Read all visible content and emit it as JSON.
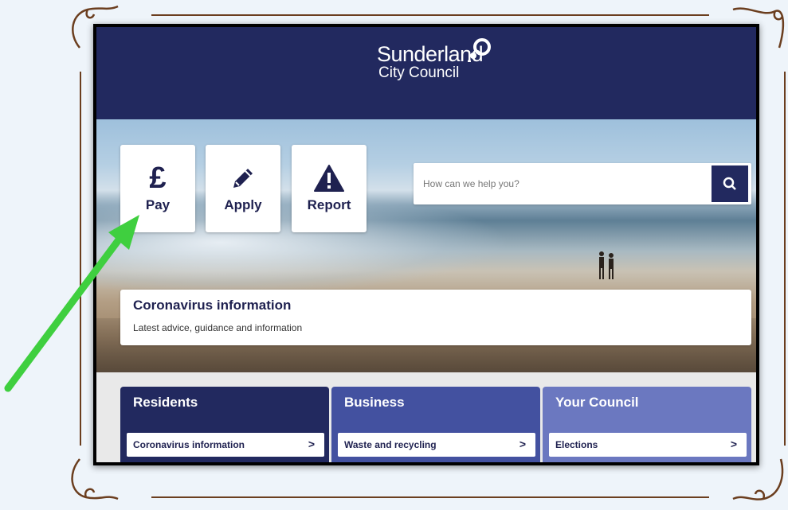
{
  "colors": {
    "header_navy": "#22295f",
    "tab_residents": "#22295f",
    "tab_business": "#4351a0",
    "tab_council": "#6b78c0",
    "arrow_green": "#3fcf3f",
    "frame_brown": "#6b3e1f"
  },
  "header": {
    "logo_line1": "Sunderland",
    "logo_line2": "City Council"
  },
  "quick_actions": [
    {
      "label": "Pay",
      "icon": "pound-icon"
    },
    {
      "label": "Apply",
      "icon": "pencil-icon"
    },
    {
      "label": "Report",
      "icon": "warning-icon"
    }
  ],
  "search": {
    "placeholder": "How can we help you?",
    "icon": "search-icon"
  },
  "covid": {
    "title": "Coronavirus information",
    "subtitle": "Latest advice, guidance and information"
  },
  "tabs": [
    {
      "title": "Residents",
      "link": "Coronavirus information"
    },
    {
      "title": "Business",
      "link": "Waste and recycling"
    },
    {
      "title": "Your Council",
      "link": "Elections"
    }
  ],
  "chevron": ">"
}
